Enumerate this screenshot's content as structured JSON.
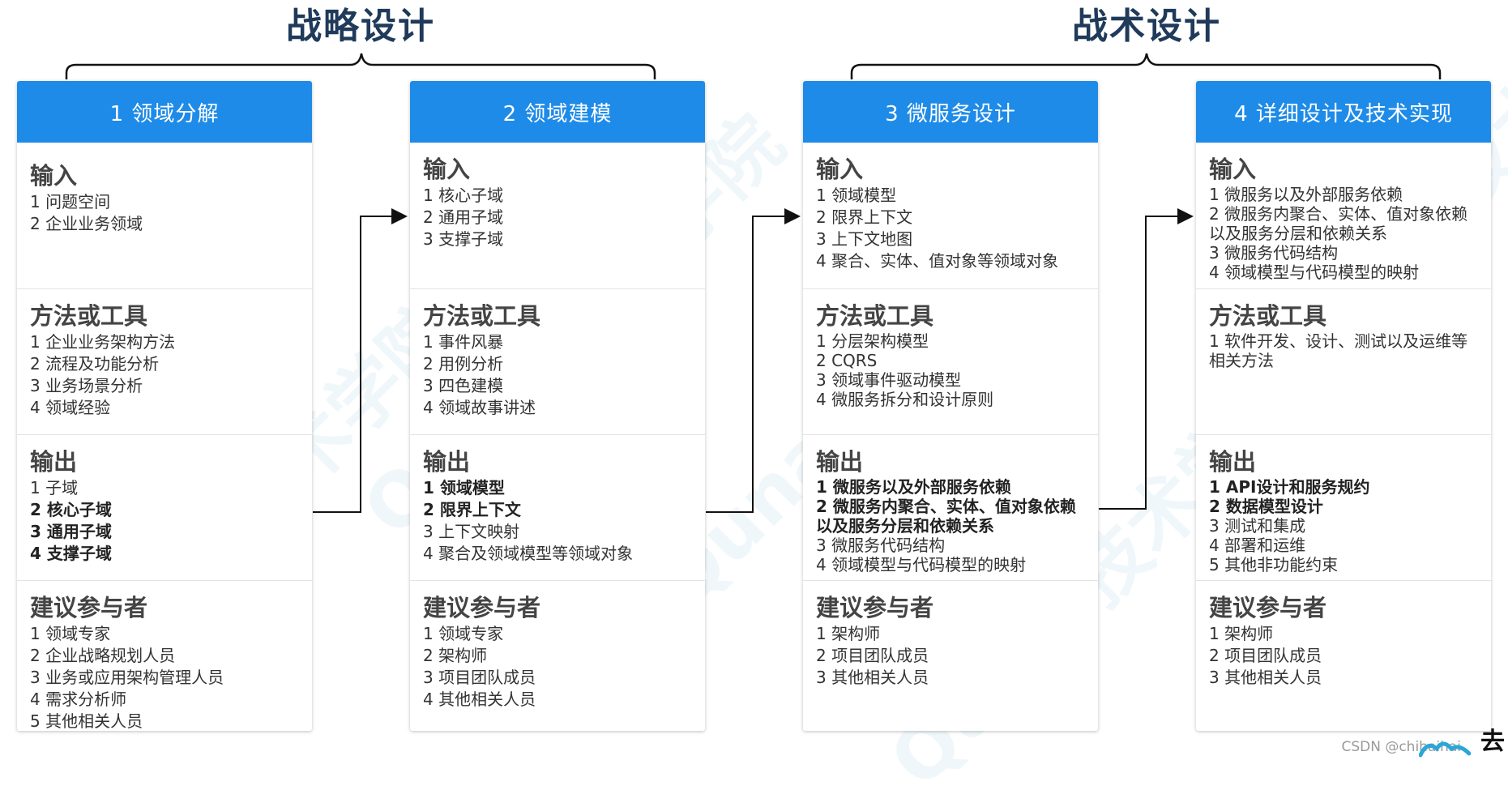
{
  "groups": {
    "strategic": "战略设计",
    "tactical": "战术设计"
  },
  "watermark": "Qunar技术学院",
  "cards": [
    {
      "header": "1 领域分解",
      "sections": [
        {
          "title": "输入",
          "items": [
            {
              "t": "1 问题空间"
            },
            {
              "t": "2 企业业务领域"
            }
          ]
        },
        {
          "title": "方法或工具",
          "items": [
            {
              "t": "1 企业业务架构方法"
            },
            {
              "t": "2 流程及功能分析"
            },
            {
              "t": "3 业务场景分析"
            },
            {
              "t": "4 领域经验"
            }
          ]
        },
        {
          "title": "输出",
          "items": [
            {
              "t": "1 子域"
            },
            {
              "t": "2 核心子域",
              "b": true
            },
            {
              "t": "3 通用子域",
              "b": true
            },
            {
              "t": "4 支撑子域",
              "b": true
            }
          ]
        },
        {
          "title": "建议参与者",
          "items": [
            {
              "t": "1 领域专家"
            },
            {
              "t": "2 企业战略规划人员"
            },
            {
              "t": "3 业务或应用架构管理人员"
            },
            {
              "t": "4 需求分析师"
            },
            {
              "t": "5 其他相关人员"
            }
          ]
        }
      ]
    },
    {
      "header": "2 领域建模",
      "sections": [
        {
          "title": "输入",
          "items": [
            {
              "t": "1 核心子域"
            },
            {
              "t": "2 通用子域"
            },
            {
              "t": "3 支撑子域"
            }
          ]
        },
        {
          "title": "方法或工具",
          "items": [
            {
              "t": "1 事件风暴"
            },
            {
              "t": "2 用例分析"
            },
            {
              "t": "3 四色建模"
            },
            {
              "t": "4 领域故事讲述"
            }
          ]
        },
        {
          "title": "输出",
          "items": [
            {
              "t": "1 领域模型",
              "b": true
            },
            {
              "t": "2 限界上下文",
              "b": true
            },
            {
              "t": "3 上下文映射"
            },
            {
              "t": "4 聚合及领域模型等领域对象"
            }
          ]
        },
        {
          "title": "建议参与者",
          "items": [
            {
              "t": "1 领域专家"
            },
            {
              "t": "2 架构师"
            },
            {
              "t": "3 项目团队成员"
            },
            {
              "t": "4 其他相关人员"
            }
          ]
        }
      ]
    },
    {
      "header": "3 微服务设计",
      "sections": [
        {
          "title": "输入",
          "items": [
            {
              "t": "1 领域模型"
            },
            {
              "t": "2 限界上下文"
            },
            {
              "t": "3 上下文地图"
            },
            {
              "t": "4 聚合、实体、值对象等领域对象"
            }
          ]
        },
        {
          "title": "方法或工具",
          "items": [
            {
              "t": "1 分层架构模型"
            },
            {
              "t": "2 CQRS"
            },
            {
              "t": "3 领域事件驱动模型"
            },
            {
              "t": "4 微服务拆分和设计原则"
            }
          ]
        },
        {
          "title": "输出",
          "items": [
            {
              "t": "1 微服务以及外部服务依赖",
              "b": true
            },
            {
              "t": "2 微服务内聚合、实体、值对象依赖以及服务分层和依赖关系",
              "b": true
            },
            {
              "t": "3 微服务代码结构"
            },
            {
              "t": "4 领域模型与代码模型的映射"
            }
          ]
        },
        {
          "title": "建议参与者",
          "items": [
            {
              "t": "1 架构师"
            },
            {
              "t": "2 项目团队成员"
            },
            {
              "t": "3 其他相关人员"
            }
          ]
        }
      ]
    },
    {
      "header": "4 详细设计及技术实现",
      "sections": [
        {
          "title": "输入",
          "items": [
            {
              "t": "1 微服务以及外部服务依赖"
            },
            {
              "t": "2 微服务内聚合、实体、值对象依赖以及服务分层和依赖关系"
            },
            {
              "t": "3 微服务代码结构"
            },
            {
              "t": "4 领域模型与代码模型的映射"
            }
          ]
        },
        {
          "title": "方法或工具",
          "items": [
            {
              "t": "1 软件开发、设计、测试以及运维等相关方法"
            }
          ]
        },
        {
          "title": "输出",
          "items": [
            {
              "t": "1 API设计和服务规约",
              "b": true
            },
            {
              "t": "2 数据模型设计",
              "b": true
            },
            {
              "t": "3 测试和集成"
            },
            {
              "t": "4 部署和运维"
            },
            {
              "t": "5 其他非功能约束"
            }
          ]
        },
        {
          "title": "建议参与者",
          "items": [
            {
              "t": "1 架构师"
            },
            {
              "t": "2 项目团队成员"
            },
            {
              "t": "3 其他相关人员"
            }
          ]
        }
      ]
    }
  ],
  "credit": "CSDN @chihaihai",
  "logo_char": "去",
  "colors": {
    "header": "#1e8be8",
    "title": "#1f3a5a"
  }
}
